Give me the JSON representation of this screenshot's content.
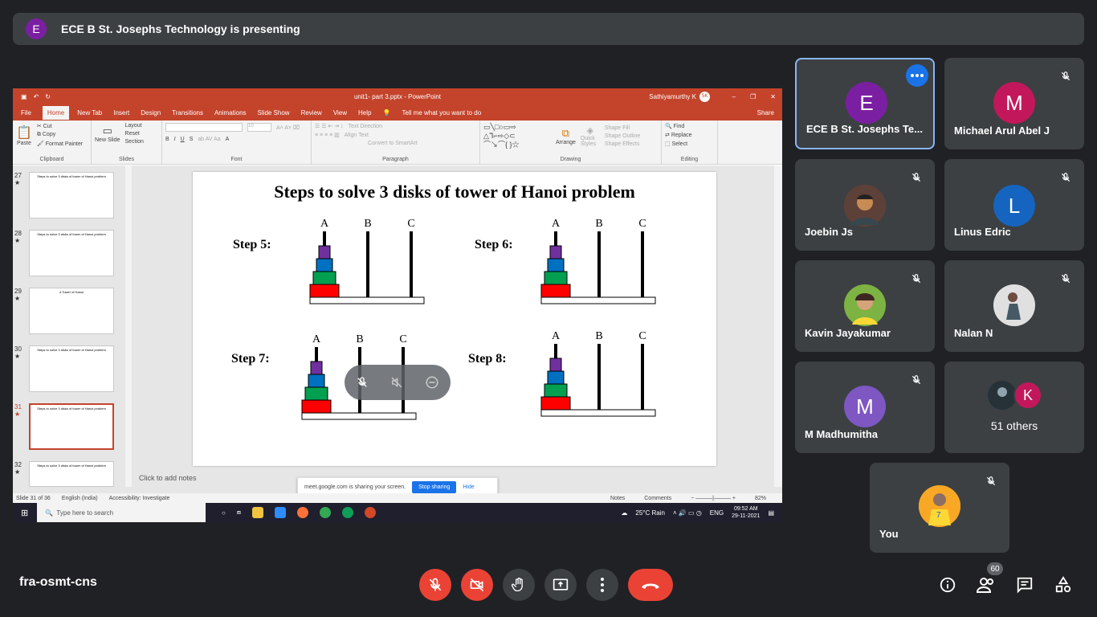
{
  "banner": {
    "avatar_letter": "E",
    "text": "ECE B St. Josephs Technology is presenting"
  },
  "ppt": {
    "doc_title": "unit1- part 3.pptx  -  PowerPoint",
    "user": "Sathiyamurthy K",
    "user_initials": "SK",
    "tabs": [
      "File",
      "Home",
      "New Tab",
      "Insert",
      "Design",
      "Transitions",
      "Animations",
      "Slide Show",
      "Review",
      "View",
      "Help"
    ],
    "tell_me": "Tell me what you want to do",
    "share": "Share",
    "ribbon": {
      "clipboard": {
        "paste": "Paste",
        "cut": "Cut",
        "copy": "Copy",
        "format_painter": "Format Painter",
        "label": "Clipboard"
      },
      "slides": {
        "new_slide": "New Slide",
        "layout": "Layout",
        "reset": "Reset",
        "section": "Section",
        "label": "Slides"
      },
      "font": {
        "label": "Font",
        "size": "10"
      },
      "paragraph": {
        "label": "Paragraph",
        "text_direction": "Text Direction",
        "align_text": "Align Text",
        "convert": "Convert to SmartArt"
      },
      "drawing": {
        "label": "Drawing",
        "arrange": "Arrange",
        "quick_styles": "Quick Styles",
        "shape_fill": "Shape Fill",
        "shape_outline": "Shape Outline",
        "shape_effects": "Shape Effects"
      },
      "editing": {
        "label": "Editing",
        "find": "Find",
        "replace": "Replace",
        "select": "Select"
      }
    },
    "thumbnails": [
      {
        "num": "27",
        "title": "Steps to solve 3 disks of tower of Hanoi problem"
      },
      {
        "num": "28",
        "title": "Steps to solve 3 disks of tower of Hanoi problem"
      },
      {
        "num": "29",
        "title": "4.Tower of Hanoi"
      },
      {
        "num": "30",
        "title": "Steps to solve 3 disks of tower of Hanoi problem"
      },
      {
        "num": "31",
        "title": "Steps to solve 3 disks of tower of Hanoi problem"
      },
      {
        "num": "32",
        "title": "Steps to solve 3 disks of tower of Hanoi problem"
      }
    ],
    "slide": {
      "title": "Steps to solve 3 disks of tower of Hanoi problem",
      "steps": [
        "Step 5:",
        "Step 6:",
        "Step 7:",
        "Step 8:"
      ],
      "pegs": [
        "A",
        "B",
        "C"
      ]
    },
    "notes_placeholder": "Click to add notes",
    "status": {
      "slide": "Slide 31 of 36",
      "language": "English (India)",
      "accessibility": "Accessibility: Investigate",
      "notes": "Notes",
      "comments": "Comments",
      "zoom": "82%"
    },
    "share_bar": {
      "text": "meet.google.com is sharing your screen.",
      "stop": "Stop sharing",
      "hide": "Hide"
    },
    "taskbar": {
      "search": "Type here to search",
      "weather": "25°C  Rain",
      "lang": "ENG",
      "time": "09:52 AM",
      "date": "29-11-2021"
    }
  },
  "participants": [
    {
      "name": "ECE B St. Josephs Te...",
      "letter": "E",
      "color": "#7b1fa2"
    },
    {
      "name": "Michael Arul Abel J",
      "letter": "M",
      "color": "#c2185b"
    },
    {
      "name": "Joebin Js",
      "letter": "",
      "color": "#6d4c41"
    },
    {
      "name": "Linus Edric",
      "letter": "L",
      "color": "#1565c0"
    },
    {
      "name": "Kavin Jayakumar",
      "letter": "",
      "color": "#8d6e63"
    },
    {
      "name": "Nalan N",
      "letter": "",
      "color": "#9e9e9e"
    },
    {
      "name": "M Madhumitha",
      "letter": "M",
      "color": "#7e57c2"
    },
    {
      "name": "51 others",
      "letter": "K",
      "color": "#c2185b"
    },
    {
      "name": "You",
      "letter": "",
      "color": "#f9a825"
    }
  ],
  "meeting": {
    "code": "fra-osmt-cns",
    "people_count": "60"
  },
  "colors": {
    "end_call": "#ea4335",
    "accent": "#1a73e8",
    "tile": "#3c4043",
    "bg": "#202124"
  }
}
